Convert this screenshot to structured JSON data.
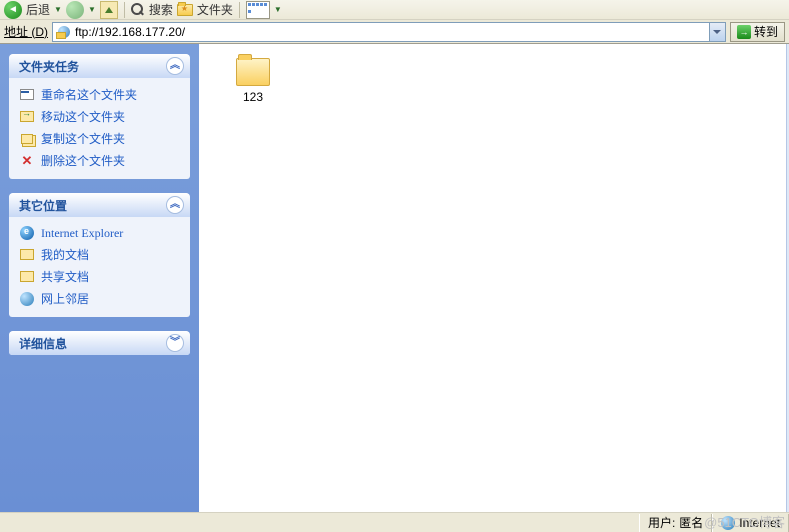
{
  "toolbar": {
    "back_label": "后退",
    "search_label": "搜索",
    "folders_label": "文件夹"
  },
  "addressbar": {
    "label_prefix": "地址 (",
    "label_key": "D",
    "label_suffix": ")",
    "value": "ftp://192.168.177.20/",
    "go_label": "转到"
  },
  "sidebar": {
    "panels": [
      {
        "title": "文件夹任务",
        "items": [
          {
            "label": "重命名这个文件夹"
          },
          {
            "label": "移动这个文件夹"
          },
          {
            "label": "复制这个文件夹"
          },
          {
            "label": "删除这个文件夹"
          }
        ]
      },
      {
        "title": "其它位置",
        "items": [
          {
            "label": "Internet Explorer"
          },
          {
            "label": "我的文档"
          },
          {
            "label": "共享文档"
          },
          {
            "label": "网上邻居"
          }
        ]
      },
      {
        "title": "详细信息",
        "items": []
      }
    ]
  },
  "content": {
    "folders": [
      {
        "name": "123"
      }
    ]
  },
  "statusbar": {
    "user_label": "用户:",
    "user_value": "匿名",
    "zone_label": "Internet"
  },
  "watermark": "@51CTO博客"
}
